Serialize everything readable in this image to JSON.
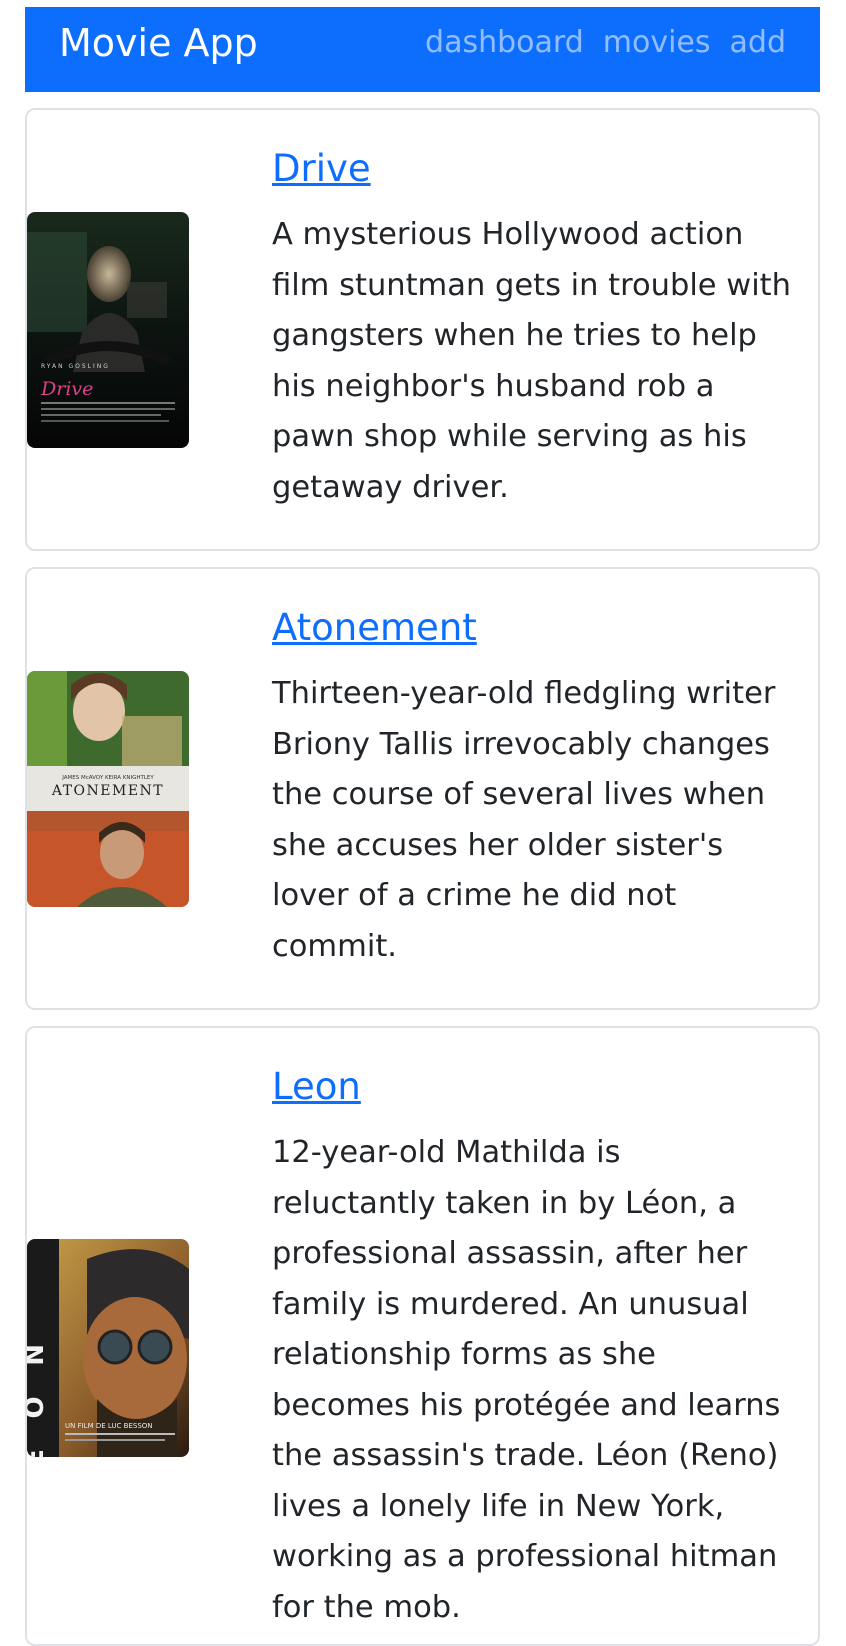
{
  "navbar": {
    "brand": "Movie App",
    "links": [
      "dashboard",
      "movies",
      "add"
    ],
    "background": "#0d6efd"
  },
  "movies": [
    {
      "title": "Drive",
      "overview": "A mysterious Hollywood action film stuntman gets in trouble with gangsters when he tries to help his neighbor's husband rob a pawn shop while serving as his getaway driver.",
      "poster_text": "Drive",
      "poster_credit": "RYAN GOSLING"
    },
    {
      "title": "Atonement",
      "overview": "Thirteen-year-old fledgling writer Briony Tallis irrevocably changes the course of several lives when she accuses her older sister's lover of a crime he did not commit.",
      "poster_text": "ATONEMENT",
      "poster_credit": "JAMES McAVOY   KEIRA KNIGHTLEY"
    },
    {
      "title": "Leon",
      "overview": "12-year-old Mathilda is reluctantly taken in by Léon, a professional assassin, after her family is murdered. An unusual relationship forms as she becomes his protégée and learns the assassin's trade. Léon (Reno) lives a lonely life in New York, working as a professional hitman for the mob.",
      "poster_text": "LÉON",
      "poster_credit": "UN FILM DE LUC BESSON"
    }
  ]
}
